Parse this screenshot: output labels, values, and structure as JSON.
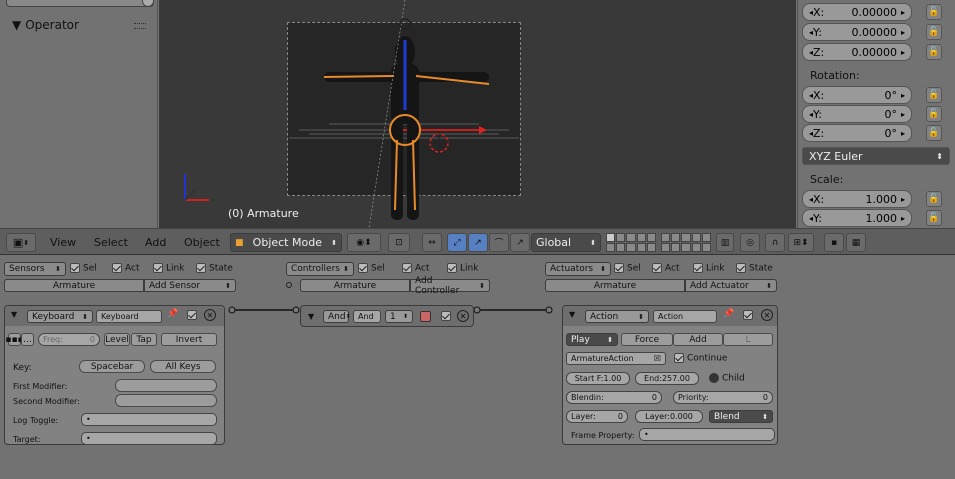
{
  "operator_panel": {
    "title": "Operator"
  },
  "viewport": {
    "object_label": "(0) Armature"
  },
  "transform": {
    "location": [
      {
        "axis": "X:",
        "value": "0.00000"
      },
      {
        "axis": "Y:",
        "value": "0.00000"
      },
      {
        "axis": "Z:",
        "value": "0.00000"
      }
    ],
    "rotation_label": "Rotation:",
    "rotation": [
      {
        "axis": "X:",
        "value": "0°"
      },
      {
        "axis": "Y:",
        "value": "0°"
      },
      {
        "axis": "Z:",
        "value": "0°"
      }
    ],
    "rotation_mode": "XYZ Euler",
    "scale_label": "Scale:",
    "scale": [
      {
        "axis": "X:",
        "value": "1.000"
      },
      {
        "axis": "Y:",
        "value": "1.000"
      }
    ]
  },
  "header": {
    "view": "View",
    "select": "Select",
    "add": "Add",
    "object": "Object",
    "mode": "Object Mode",
    "orientation": "Global"
  },
  "logic": {
    "sensors": {
      "dropdown": "Sensors",
      "sel": "Sel",
      "act": "Act",
      "link": "Link",
      "state": "State",
      "object": "Armature",
      "add": "Add Sensor"
    },
    "controllers": {
      "dropdown": "Controllers",
      "sel": "Sel",
      "act": "Act",
      "link": "Link",
      "object": "Armature",
      "add": "Add Controller"
    },
    "actuators": {
      "dropdown": "Actuators",
      "sel": "Sel",
      "act": "Act",
      "link": "Link",
      "state": "State",
      "object": "Armature",
      "add": "Add Actuator"
    }
  },
  "sensor": {
    "type": "Keyboard",
    "name": "Keyboard",
    "freq": "Freq:",
    "freq_value": "0",
    "level": "Level",
    "tap": "Tap",
    "invert": "Invert",
    "key_label": "Key:",
    "key_value": "Spacebar",
    "all_keys": "All Keys",
    "first_modifier": "First Modifier:",
    "second_modifier": "Second Modifier:",
    "log_toggle": "Log Toggle:",
    "target": "Target:"
  },
  "controller": {
    "type": "And",
    "name": "And",
    "state": "1"
  },
  "actuator": {
    "type": "Action",
    "name": "Action",
    "play": "Play",
    "force": "Force",
    "add": "Add",
    "l": "L",
    "action_name": "ArmatureAction",
    "continue": "Continue",
    "start": "Start F:1.00",
    "end": "End:257.00",
    "child": "Child",
    "blendin_label": "Blendin:",
    "blendin_value": "0",
    "priority_label": "Priority:",
    "priority_value": "0",
    "layer_label": "Layer:",
    "layer_value": "0",
    "layer_weight": "Layer:0.000",
    "blend_mode": "Blend",
    "frame_property": "Frame Property:"
  }
}
